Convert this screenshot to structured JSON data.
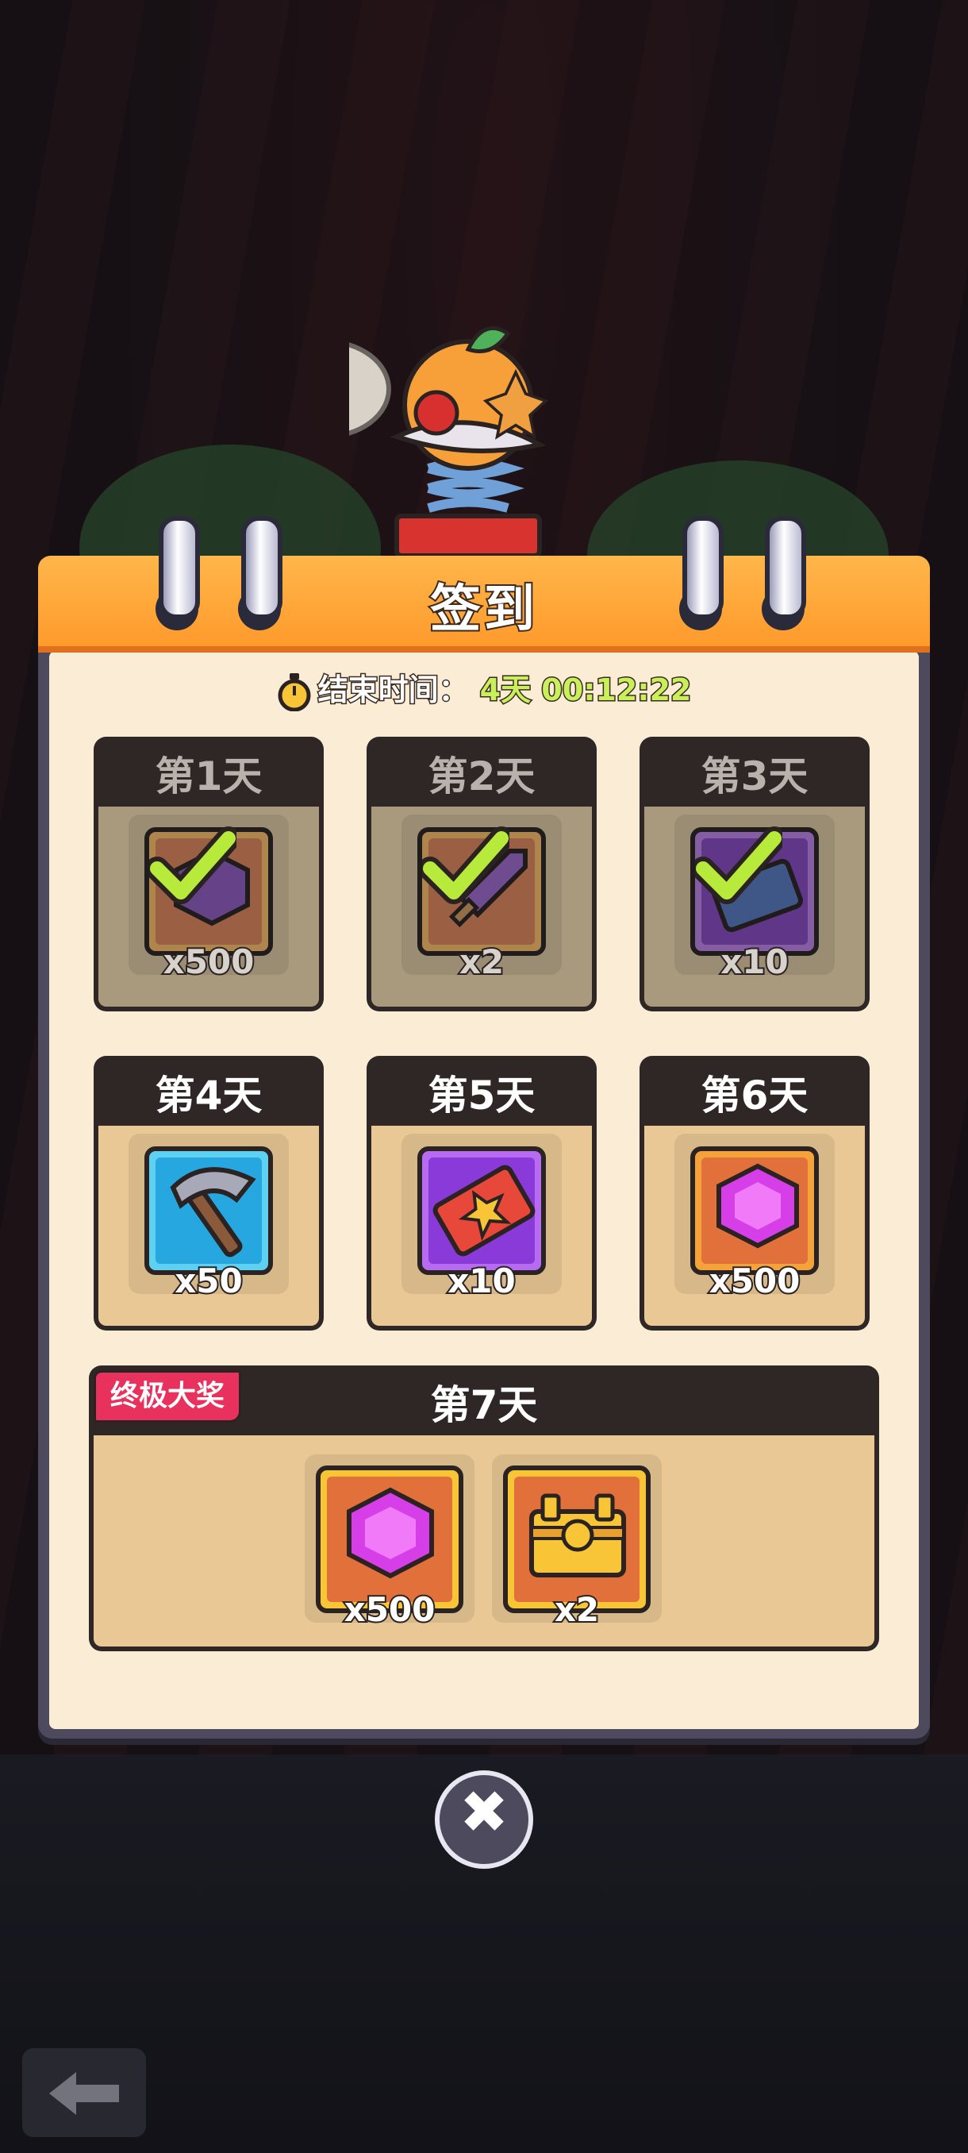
{
  "dialog": {
    "title": "签到",
    "timer_label": "结束时间：",
    "timer_value": "4天 00:12:22"
  },
  "days": [
    {
      "title": "第1天",
      "qty": "x500",
      "item": "purple-gem-icon",
      "claimed": true
    },
    {
      "title": "第2天",
      "qty": "x2",
      "item": "sword-icon",
      "claimed": true
    },
    {
      "title": "第3天",
      "qty": "x10",
      "item": "ticket-icon",
      "claimed": true
    },
    {
      "title": "第4天",
      "qty": "x50",
      "item": "hammer-icon",
      "claimed": false
    },
    {
      "title": "第5天",
      "qty": "x10",
      "item": "star-ticket-icon",
      "claimed": false
    },
    {
      "title": "第6天",
      "qty": "x500",
      "item": "purple-gem-icon",
      "claimed": false
    }
  ],
  "grand_prize": {
    "badge": "终极大奖",
    "title": "第7天",
    "rewards": [
      {
        "qty": "x500",
        "item": "purple-gem-icon"
      },
      {
        "qty": "x2",
        "item": "treasure-chest-icon"
      }
    ]
  },
  "colors": {
    "header": "#ff9a2c",
    "timer_value": "#c8f05a",
    "badge": "#e8315c",
    "card_bg": "#eac895"
  }
}
